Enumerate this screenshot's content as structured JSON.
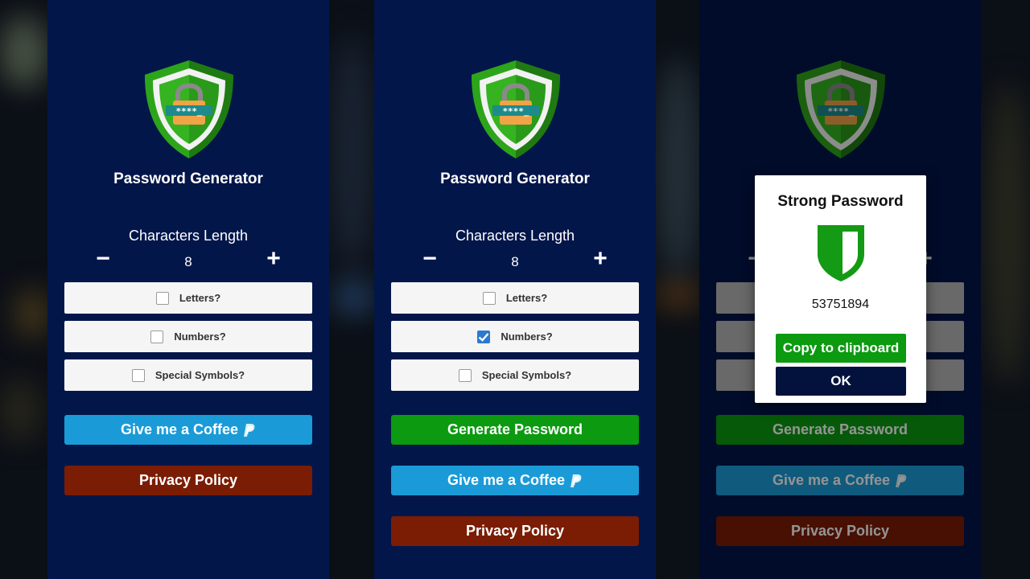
{
  "colors": {
    "screen_bg": "#03164a",
    "option_bg": "#f5f5f5",
    "coffee": "#1a9bd8",
    "privacy": "#7b1d04",
    "generate": "#0b9a10",
    "ok": "#02123d",
    "checkbox_checked": "#2a7ad1"
  },
  "screen1": {
    "title": "Password Generator",
    "length_label": "Characters Length",
    "length_value": "8",
    "minus_icon": "minus-icon",
    "plus_icon": "plus-icon",
    "options": [
      {
        "label": "Letters?",
        "checked": false
      },
      {
        "label": "Numbers?",
        "checked": false
      },
      {
        "label": "Special Symbols?",
        "checked": false
      }
    ],
    "coffee_label": "Give me a Coffee",
    "privacy_label": "Privacy Policy"
  },
  "screen2": {
    "title": "Password Generator",
    "length_label": "Characters Length",
    "length_value": "8",
    "options": [
      {
        "label": "Letters?",
        "checked": false
      },
      {
        "label": "Numbers?",
        "checked": true
      },
      {
        "label": "Special Symbols?",
        "checked": false
      }
    ],
    "generate_label": "Generate Password",
    "coffee_label": "Give me a Coffee",
    "privacy_label": "Privacy Policy"
  },
  "screen3": {
    "generate_label": "Generate Password",
    "coffee_label": "Give me a Coffee",
    "privacy_label": "Privacy Policy",
    "dialog": {
      "title": "Strong Password",
      "password": "53751894",
      "copy_label": "Copy to clipboard",
      "ok_label": "OK"
    }
  }
}
